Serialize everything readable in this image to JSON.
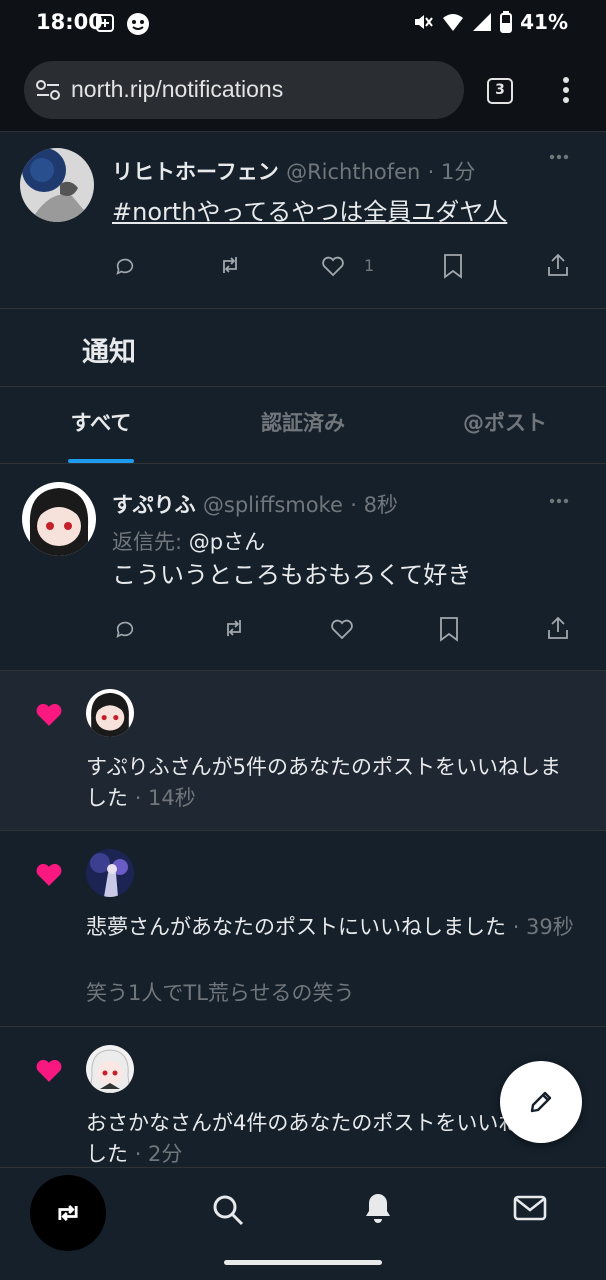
{
  "status_bar": {
    "time": "18:00",
    "battery": "41%"
  },
  "browser": {
    "url": "north.rip/notifications",
    "tab_count": "3"
  },
  "top_post": {
    "display_name": "リヒトホーフェン",
    "handle": "@Richthofen",
    "time": "· 1分",
    "text": "#northやってるやつは全員ユダヤ人",
    "like_count": "1"
  },
  "page_title": "通知",
  "tabs": [
    {
      "label": "すべて",
      "active": true
    },
    {
      "label": "認証済み",
      "active": false
    },
    {
      "label": "@ポスト",
      "active": false
    }
  ],
  "reply_post": {
    "display_name": "すぷりふ",
    "handle": "@spliffsmoke",
    "time": "· 8秒",
    "reply_prefix": "返信先:",
    "reply_target": "@pさん",
    "text": "こういうところもおもろくて好き"
  },
  "notifications": [
    {
      "text": "すぷりふさんが5件のあなたのポストをいいねしました",
      "time": "· 14秒",
      "subtext": ""
    },
    {
      "text": "悲夢さんがあなたのポストにいいねしました",
      "time": "· 39秒",
      "subtext": "笑う1人でTL荒らせるの笑う"
    },
    {
      "text": "おさかなさんが4件のあなたのポストをいいねしました",
      "time": "· 2分",
      "subtext": ""
    }
  ],
  "icons": {
    "more": "more-horizontal-icon",
    "reply": "reply-icon",
    "repost": "repost-icon",
    "like": "heart-icon",
    "bookmark": "bookmark-icon",
    "share": "share-icon",
    "compose": "pencil-icon",
    "nav": [
      "repost-home-icon",
      "search-icon",
      "bell-icon",
      "mail-icon"
    ]
  },
  "colors": {
    "background": "#15202b",
    "like_pink": "#f91880",
    "accent": "#1d9bf0",
    "muted": "#71767b"
  }
}
